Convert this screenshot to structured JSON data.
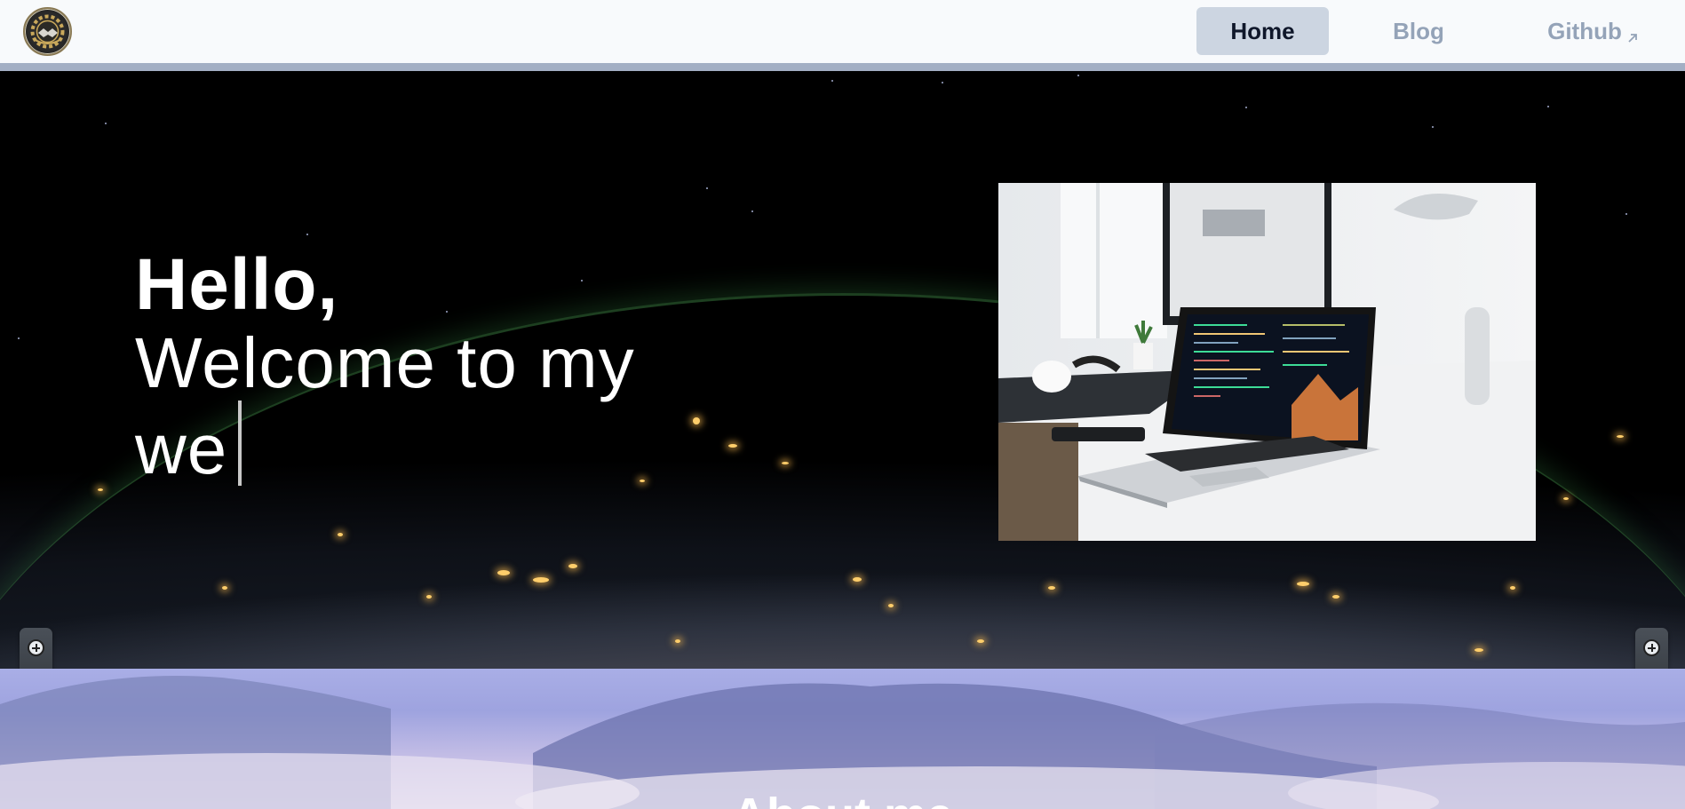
{
  "header": {
    "logo_icon": "gear-handshake-logo-icon",
    "nav": {
      "home": "Home",
      "blog": "Blog",
      "github": "Github",
      "github_icon": "external-link-arrow-icon"
    },
    "active_tab": "Home",
    "colors": {
      "active_bg": "#ccd5e1",
      "active_text": "#0f172a",
      "inactive_text": "#94a3b8",
      "strip": "#a3afc4"
    }
  },
  "hero": {
    "greeting": "Hello,",
    "typed_line1": "Welcome to my",
    "typed_line2": "we",
    "background": "earth-at-night-from-space",
    "image": "laptop-on-desk-photo"
  },
  "side_controls": {
    "icon": "plus-circle-icon"
  },
  "about": {
    "title": "About me",
    "background": "misty-mountains"
  }
}
